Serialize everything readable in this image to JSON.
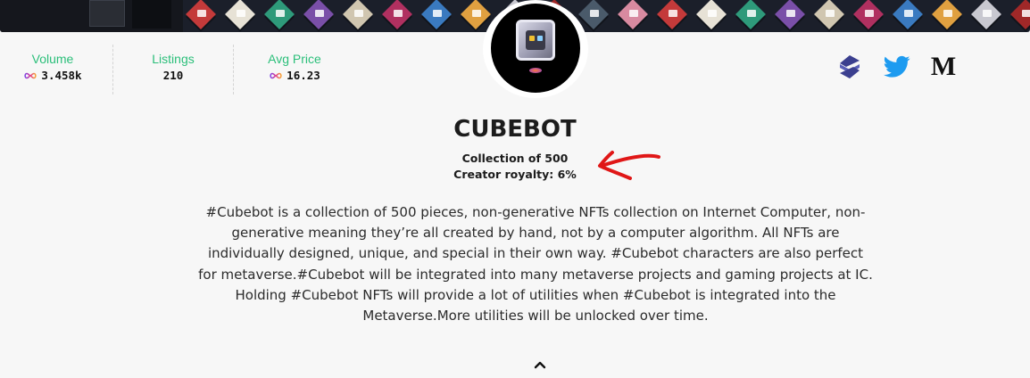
{
  "stats": {
    "volume": {
      "label": "Volume",
      "value": "3.458k",
      "icon": "icp-infinity-icon"
    },
    "listings": {
      "label": "Listings",
      "value": "210"
    },
    "avg_price": {
      "label": "Avg Price",
      "value": "16.23",
      "icon": "icp-infinity-icon"
    }
  },
  "social": [
    "distrikt-icon",
    "twitter-icon",
    "medium-icon"
  ],
  "social_medium_glyph": "M",
  "collection": {
    "name": "CUBEBOT",
    "size_text": "Collection of 500",
    "royalty_text": "Creator royalty: 6%",
    "description": "#Cubebot is a collection of 500 pieces, non-generative NFTs collection on Internet Computer, non-generative meaning they’re all created by hand, not by a computer algorithm. All NFTs are individually designed, unique, and special in their own way. #Cubebot characters are also perfect for metaverse.#Cubebot will be integrated into many metaverse projects and gaming projects at IC. Holding #Cubebot NFTs will provide a lot of utilities when #Cubebot is integrated into the Metaverse.More utilities will be unlocked over time."
  },
  "colors": {
    "accent_green": "#2bbf7a",
    "twitter_blue": "#1d9bf0",
    "annotation_red": "#e01717",
    "banner_bg": "#1b1f2a"
  },
  "icons": {
    "collapse": "chevron-up-icon",
    "annotation": "red-arrow-annotation"
  }
}
